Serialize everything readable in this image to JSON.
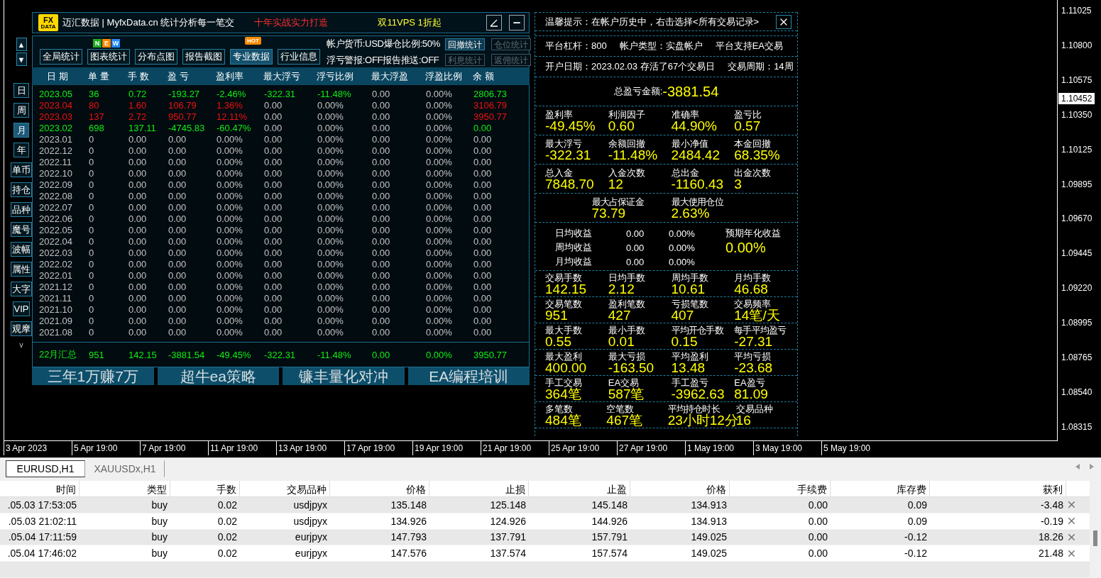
{
  "chart": {
    "price_ticks": [
      "1.11025",
      "1.10800",
      "1.10575",
      "1.10350",
      "1.10125",
      "1.09895",
      "1.09670",
      "1.09445",
      "1.09220",
      "1.08995",
      "1.08765",
      "1.08540",
      "1.08315"
    ],
    "current_price": "1.10452",
    "time_ticks": [
      "3 Apr 2023",
      "5 Apr 19:00",
      "7 Apr 19:00",
      "11 Apr 19:00",
      "13 Apr 19:00",
      "17 Apr 19:00",
      "19 Apr 19:00",
      "21 Apr 19:00",
      "25 Apr 19:00",
      "27 Apr 19:00",
      "1 May 19:00",
      "3 May 19:00",
      "5 May 19:00"
    ]
  },
  "side_nav": {
    "scroll_buttons": [
      "▲",
      "▼"
    ],
    "periods": [
      {
        "label": "日",
        "selected": false
      },
      {
        "label": "周",
        "selected": false
      },
      {
        "label": "月",
        "selected": true
      },
      {
        "label": "年",
        "selected": false
      }
    ],
    "tools": [
      "单币",
      "持仓",
      "品种",
      "魔号",
      "波幅",
      "属性",
      "大字",
      "VIP",
      "观摩"
    ],
    "more": "v"
  },
  "header": {
    "logo": [
      "FX",
      "DATA"
    ],
    "title": "迈汇数据 | MyfxData.cn  统计分析每一笔交",
    "slogan": "十年实战实力打造",
    "promo": "双11VPS 1折起"
  },
  "toolbar": {
    "buttons": [
      {
        "label": "全局统计",
        "selected": false
      },
      {
        "label": "图表统计",
        "selected": false,
        "new_letters": [
          {
            "text": "N",
            "color": "#22aa22"
          },
          {
            "text": "E",
            "color": "#ff8800"
          },
          {
            "text": "W",
            "color": "#2288ff"
          }
        ]
      },
      {
        "label": "分布点图",
        "selected": false
      },
      {
        "label": "报告截图",
        "selected": false
      },
      {
        "label": "专业数据",
        "selected": true,
        "hot": "HOT"
      },
      {
        "label": "行业信息",
        "selected": false
      }
    ],
    "info": [
      "帐户货币:USD爆仓比例:50%",
      "浮亏警报:OFF报告推送:OFF"
    ],
    "small_buttons": [
      {
        "label": "回撤统计",
        "disabled": false
      },
      {
        "label": "仓位统计",
        "disabled": true
      },
      {
        "label": "利息统计",
        "disabled": true
      },
      {
        "label": "返佣统计",
        "disabled": true
      }
    ]
  },
  "stat_table": {
    "columns": [
      "日 期",
      "单 量",
      "手 数",
      "盈 亏",
      "盈利率",
      "最大浮亏",
      "浮亏比例",
      "最大浮盈",
      "浮盈比例",
      "余 额"
    ],
    "rows": [
      {
        "color": "#11ee11",
        "cells": [
          {
            "text": "2023.05",
            "tinted": true
          },
          {
            "text": "36",
            "tinted": true
          },
          {
            "text": "0.72",
            "tinted": true
          },
          {
            "text": "-193.27",
            "tinted": true
          },
          {
            "text": "-2.46%",
            "tinted": true
          },
          {
            "text": "-322.31",
            "tinted": true
          },
          {
            "text": "-11.48%",
            "tinted": true
          },
          {
            "text": "0.00",
            "tinted": false
          },
          {
            "text": "0.00%",
            "tinted": false
          },
          {
            "text": "2806.73",
            "tinted": true
          }
        ]
      },
      {
        "color": "#ee1111",
        "cells": [
          {
            "text": "2023.04",
            "tinted": true
          },
          {
            "text": "80",
            "tinted": true
          },
          {
            "text": "1.60",
            "tinted": true
          },
          {
            "text": "106.79",
            "tinted": true
          },
          {
            "text": "1.36%",
            "tinted": true
          },
          {
            "text": "0.00",
            "tinted": false
          },
          {
            "text": "0.00%",
            "tinted": false
          },
          {
            "text": "0.00",
            "tinted": false
          },
          {
            "text": "0.00%",
            "tinted": false
          },
          {
            "text": "3106.79",
            "tinted": true
          }
        ]
      },
      {
        "color": "#ee1111",
        "cells": [
          {
            "text": "2023.03",
            "tinted": true
          },
          {
            "text": "137",
            "tinted": true
          },
          {
            "text": "2.72",
            "tinted": true
          },
          {
            "text": "950.77",
            "tinted": true
          },
          {
            "text": "12.11%",
            "tinted": true
          },
          {
            "text": "0.00",
            "tinted": false
          },
          {
            "text": "0.00%",
            "tinted": false
          },
          {
            "text": "0.00",
            "tinted": false
          },
          {
            "text": "0.00%",
            "tinted": false
          },
          {
            "text": "3950.77",
            "tinted": true
          }
        ]
      },
      {
        "color": "#11ee11",
        "cells": [
          {
            "text": "2023.02",
            "tinted": true
          },
          {
            "text": "698",
            "tinted": true
          },
          {
            "text": "137.11",
            "tinted": true
          },
          {
            "text": "-4745.83",
            "tinted": true
          },
          {
            "text": "-60.47%",
            "tinted": true
          },
          {
            "text": "0.00",
            "tinted": false
          },
          {
            "text": "0.00%",
            "tinted": false
          },
          {
            "text": "0.00",
            "tinted": false
          },
          {
            "text": "0.00%",
            "tinted": false
          },
          {
            "text": "0.00",
            "tinted": true
          }
        ]
      },
      {
        "cells": [
          "2023.01",
          "0",
          "0.00",
          "0.00",
          "0.00%",
          "0.00",
          "0.00%",
          "0.00",
          "0.00%",
          "0.00"
        ]
      },
      {
        "cells": [
          "2022.12",
          "0",
          "0.00",
          "0.00",
          "0.00%",
          "0.00",
          "0.00%",
          "0.00",
          "0.00%",
          "0.00"
        ]
      },
      {
        "cells": [
          "2022.11",
          "0",
          "0.00",
          "0.00",
          "0.00%",
          "0.00",
          "0.00%",
          "0.00",
          "0.00%",
          "0.00"
        ]
      },
      {
        "cells": [
          "2022.10",
          "0",
          "0.00",
          "0.00",
          "0.00%",
          "0.00",
          "0.00%",
          "0.00",
          "0.00%",
          "0.00"
        ]
      },
      {
        "cells": [
          "2022.09",
          "0",
          "0.00",
          "0.00",
          "0.00%",
          "0.00",
          "0.00%",
          "0.00",
          "0.00%",
          "0.00"
        ]
      },
      {
        "cells": [
          "2022.08",
          "0",
          "0.00",
          "0.00",
          "0.00%",
          "0.00",
          "0.00%",
          "0.00",
          "0.00%",
          "0.00"
        ]
      },
      {
        "cells": [
          "2022.07",
          "0",
          "0.00",
          "0.00",
          "0.00%",
          "0.00",
          "0.00%",
          "0.00",
          "0.00%",
          "0.00"
        ]
      },
      {
        "cells": [
          "2022.06",
          "0",
          "0.00",
          "0.00",
          "0.00%",
          "0.00",
          "0.00%",
          "0.00",
          "0.00%",
          "0.00"
        ]
      },
      {
        "cells": [
          "2022.05",
          "0",
          "0.00",
          "0.00",
          "0.00%",
          "0.00",
          "0.00%",
          "0.00",
          "0.00%",
          "0.00"
        ]
      },
      {
        "cells": [
          "2022.04",
          "0",
          "0.00",
          "0.00",
          "0.00%",
          "0.00",
          "0.00%",
          "0.00",
          "0.00%",
          "0.00"
        ]
      },
      {
        "cells": [
          "2022.03",
          "0",
          "0.00",
          "0.00",
          "0.00%",
          "0.00",
          "0.00%",
          "0.00",
          "0.00%",
          "0.00"
        ]
      },
      {
        "cells": [
          "2022.02",
          "0",
          "0.00",
          "0.00",
          "0.00%",
          "0.00",
          "0.00%",
          "0.00",
          "0.00%",
          "0.00"
        ]
      },
      {
        "cells": [
          "2022.01",
          "0",
          "0.00",
          "0.00",
          "0.00%",
          "0.00",
          "0.00%",
          "0.00",
          "0.00%",
          "0.00"
        ]
      },
      {
        "cells": [
          "2021.12",
          "0",
          "0.00",
          "0.00",
          "0.00%",
          "0.00",
          "0.00%",
          "0.00",
          "0.00%",
          "0.00"
        ]
      },
      {
        "cells": [
          "2021.11",
          "0",
          "0.00",
          "0.00",
          "0.00%",
          "0.00",
          "0.00%",
          "0.00",
          "0.00%",
          "0.00"
        ]
      },
      {
        "cells": [
          "2021.10",
          "0",
          "0.00",
          "0.00",
          "0.00%",
          "0.00",
          "0.00%",
          "0.00",
          "0.00%",
          "0.00"
        ]
      },
      {
        "cells": [
          "2021.09",
          "0",
          "0.00",
          "0.00",
          "0.00%",
          "0.00",
          "0.00%",
          "0.00",
          "0.00%",
          "0.00"
        ]
      },
      {
        "cells": [
          "2021.08",
          "0",
          "0.00",
          "0.00",
          "0.00%",
          "0.00",
          "0.00%",
          "0.00",
          "0.00%",
          "0.00"
        ]
      }
    ],
    "summary": {
      "color": "#11ee11",
      "cells": [
        "22月汇总",
        "951",
        "142.15",
        "-3881.54",
        "-49.45%",
        "-322.31",
        "-11.48%",
        "0.00",
        "0.00%",
        "3950.77"
      ]
    }
  },
  "promo_buttons": [
    "三年1万赚7万",
    "超牛ea策略",
    "镰丰量化对冲",
    "EA编程培训"
  ],
  "stats_panel": {
    "sections": [
      {
        "kind": "tip",
        "text": "温馨提示：在帐户历史中，右击选择<所有交易记录>"
      },
      {
        "kind": "info",
        "items": [
          "平台杠杆：800",
          "帐户类型：实盘帐户",
          "平台支持EA交易"
        ]
      },
      {
        "kind": "info",
        "items": [
          "开户日期：2023.02.03 存活了67个交易日",
          "交易周期：14周"
        ]
      },
      {
        "kind": "total",
        "label": "总盈亏金额:",
        "value": "-3881.54"
      },
      {
        "kind": "metrics",
        "items": [
          {
            "label": "盈利率",
            "value": "-49.45%"
          },
          {
            "label": "利润因子",
            "value": "0.60"
          },
          {
            "label": "准确率",
            "value": "44.90%"
          },
          {
            "label": "盈亏比",
            "value": "0.57"
          }
        ]
      },
      {
        "kind": "metrics",
        "items": [
          {
            "label": "最大浮亏",
            "value": "-322.31"
          },
          {
            "label": "余额回撤",
            "value": "-11.48%"
          },
          {
            "label": "最小净值",
            "value": "2484.42"
          },
          {
            "label": "本金回撤",
            "value": "68.35%"
          }
        ]
      },
      {
        "kind": "metrics",
        "items": [
          {
            "label": "总入金",
            "value": "7848.70"
          },
          {
            "label": "入金次数",
            "value": "12"
          },
          {
            "label": "总出金",
            "value": "-1160.43"
          },
          {
            "label": "出金次数",
            "value": "3"
          }
        ]
      },
      {
        "kind": "metrics",
        "items": [
          {
            "label": "最大占保证金",
            "value": "73.79"
          },
          {
            "label": "最大使用仓位",
            "value": "2.63%"
          }
        ]
      },
      {
        "kind": "averages",
        "rows": [
          [
            "日均收益",
            "0.00",
            "0.00%"
          ],
          [
            "周均收益",
            "0.00",
            "0.00%"
          ],
          [
            "月均收益",
            "0.00",
            "0.00%"
          ]
        ],
        "annual_label": "预期年化收益",
        "annual_value": "0.00%"
      },
      {
        "kind": "metrics",
        "items": [
          {
            "label": "交易手数",
            "value": "142.15"
          },
          {
            "label": "日均手数",
            "value": "2.12"
          },
          {
            "label": "周均手数",
            "value": "10.61"
          },
          {
            "label": "月均手数",
            "value": "46.68"
          }
        ]
      },
      {
        "kind": "metrics",
        "items": [
          {
            "label": "交易笔数",
            "value": "951"
          },
          {
            "label": "盈利笔数",
            "value": "427"
          },
          {
            "label": "亏损笔数",
            "value": "407"
          },
          {
            "label": "交易频率",
            "value": "14笔/天"
          }
        ]
      },
      {
        "kind": "metrics",
        "items": [
          {
            "label": "最大手数",
            "value": "0.55"
          },
          {
            "label": "最小手数",
            "value": "0.01"
          },
          {
            "label": "平均开仓手数",
            "value": "0.15"
          },
          {
            "label": "每手平均盈亏",
            "value": "-27.31"
          }
        ]
      },
      {
        "kind": "metrics",
        "items": [
          {
            "label": "最大盈利",
            "value": "400.00"
          },
          {
            "label": "最大亏损",
            "value": "-163.50"
          },
          {
            "label": "平均盈利",
            "value": "13.48"
          },
          {
            "label": "平均亏损",
            "value": "-23.68"
          }
        ]
      },
      {
        "kind": "metrics",
        "items": [
          {
            "label": "手工交易",
            "value": "364笔"
          },
          {
            "label": "EA交易",
            "value": "587笔"
          },
          {
            "label": "手工盈亏",
            "value": "-3962.63"
          },
          {
            "label": "EA盈亏",
            "value": "81.09"
          }
        ]
      },
      {
        "kind": "metrics",
        "items": [
          {
            "label": "多笔数",
            "value": "484笔"
          },
          {
            "label": "空笔数",
            "value": "467笔"
          },
          {
            "label": "平均持仓时长",
            "value": "23小时12分"
          },
          {
            "label": "交易品种",
            "value": "16"
          }
        ]
      }
    ]
  },
  "chart_tabs": [
    {
      "label": "EURUSD,H1",
      "selected": true
    },
    {
      "label": "XAUUSDx,H1",
      "selected": false
    }
  ],
  "trade_table": {
    "columns": [
      "时间",
      "类型",
      "手数",
      "交易品种",
      "价格",
      "止损",
      "止盈",
      "价格",
      "手续费",
      "库存费",
      "获利"
    ],
    "rows": [
      [
        ".05.03 17:53:05",
        "buy",
        "0.02",
        "usdjpyx",
        "135.148",
        "125.148",
        "145.148",
        "134.913",
        "0.00",
        "0.09",
        "-3.48"
      ],
      [
        ".05.03 21:02:11",
        "buy",
        "0.02",
        "usdjpyx",
        "134.926",
        "124.926",
        "144.926",
        "134.913",
        "0.00",
        "0.09",
        "-0.19"
      ],
      [
        ".05.04 17:11:59",
        "buy",
        "0.02",
        "eurjpyx",
        "147.793",
        "137.791",
        "157.791",
        "149.025",
        "0.00",
        "-0.12",
        "18.26"
      ],
      [
        ".05.04 17:46:02",
        "buy",
        "0.02",
        "eurjpyx",
        "147.576",
        "137.574",
        "157.574",
        "149.025",
        "0.00",
        "-0.12",
        "21.48"
      ]
    ]
  }
}
